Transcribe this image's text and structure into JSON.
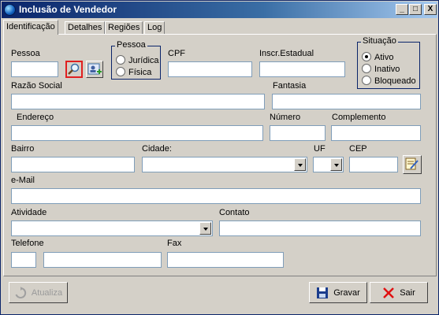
{
  "window": {
    "title": "Inclusão de Vendedor",
    "minimize": "_",
    "maximize": "□",
    "close": "X"
  },
  "tabs": [
    "Identificação",
    "Detalhes",
    "Regiões",
    "Log"
  ],
  "form": {
    "pessoa_label": "Pessoa",
    "pessoa_value": "",
    "tipo_pessoa": {
      "title": "Pessoa",
      "options": [
        "Jurídica",
        "Física"
      ]
    },
    "cpf_label": "CPF",
    "inscr_label": "Inscr.Estadual",
    "situacao": {
      "title": "Situação",
      "options": [
        "Ativo",
        "Inativo",
        "Bloqueado"
      ],
      "selected": "Ativo"
    },
    "razao_label": "Razão Social",
    "fantasia_label": "Fantasia",
    "endereco_label": "Endereço",
    "numero_label": "Número",
    "complemento_label": "Complemento",
    "bairro_label": "Bairro",
    "cidade_label": "Cidade:",
    "uf_label": "UF",
    "cep_label": "CEP",
    "email_label": "e-Mail",
    "atividade_label": "Atividade",
    "contato_label": "Contato",
    "telefone_label": "Telefone",
    "fax_label": "Fax"
  },
  "buttons": {
    "atualiza": "Atualiza",
    "gravar": "Gravar",
    "sair": "Sair"
  },
  "colors": {
    "highlight_border": "#e02020",
    "title_bar": "#0a246a",
    "close_x": "#e01010",
    "save_blue": "#1a3c8c"
  }
}
